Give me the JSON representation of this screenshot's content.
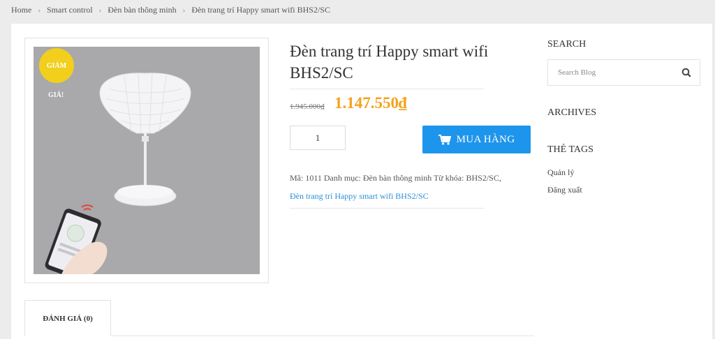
{
  "breadcrumb": {
    "items": [
      "Home",
      "Smart control",
      "Đèn bàn thông minh",
      "Đèn trang trí Happy smart wifi BHS2/SC"
    ]
  },
  "product": {
    "badge_line1": "GIẢM",
    "badge_line2": "GIÁ!",
    "title": "Đèn trang trí Happy smart wifi BHS2/SC",
    "price_old": "1.945.000₫",
    "price_new": "1.147.550₫",
    "quantity": "1",
    "buy_label": "MUA HÀNG",
    "meta_text": "Mã: 1011 Danh mục: Đèn bàn thông minh Từ khóa: BHS2/SC,",
    "meta_link": "Đèn trang trí Happy smart wifi BHS2/SC"
  },
  "tabs": {
    "reviews": "ĐÁNH GIÁ (0)"
  },
  "sidebar": {
    "search_title": "SEARCH",
    "search_placeholder": "Search Blog",
    "archives_title": "ARCHIVES",
    "tags_title": "THẺ TAGS",
    "links": [
      "Quản lý",
      "Đăng xuất"
    ]
  },
  "colors": {
    "accent": "#1e95ec",
    "price": "#f5a21d",
    "badge": "#f2cf1d"
  }
}
